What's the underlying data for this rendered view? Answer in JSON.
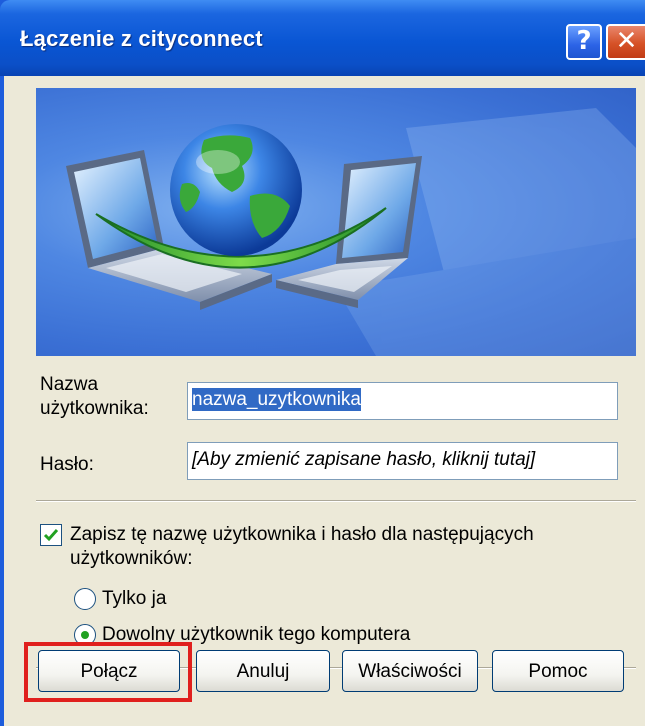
{
  "window": {
    "title": "Łączenie z cityconnect",
    "help_glyph": "?",
    "close_glyph": "✕"
  },
  "form": {
    "username_label_line1": "Nazwa",
    "username_label_line2": "użytkownika:",
    "username_value": "nazwa_uzytkownika",
    "password_label": "Hasło:",
    "password_hint": "[Aby zmienić zapisane hasło, kliknij tutaj]"
  },
  "options": {
    "save_checked": true,
    "save_label_line1": "Zapisz tę nazwę użytkownika i hasło dla następujących",
    "save_label_line2": "użytkowników:",
    "radio_only_me": "Tylko ja",
    "radio_anyone": "Dowolny użytkownik tego komputera",
    "selected_radio": "anyone"
  },
  "buttons": {
    "connect": "Połącz",
    "cancel": "Anuluj",
    "properties": "Właściwości",
    "help": "Pomoc"
  },
  "colors": {
    "titlebar": "#0a56d4",
    "dialog_bg": "#ece9d8",
    "highlight": "#e0201d",
    "check": "#21a121"
  }
}
